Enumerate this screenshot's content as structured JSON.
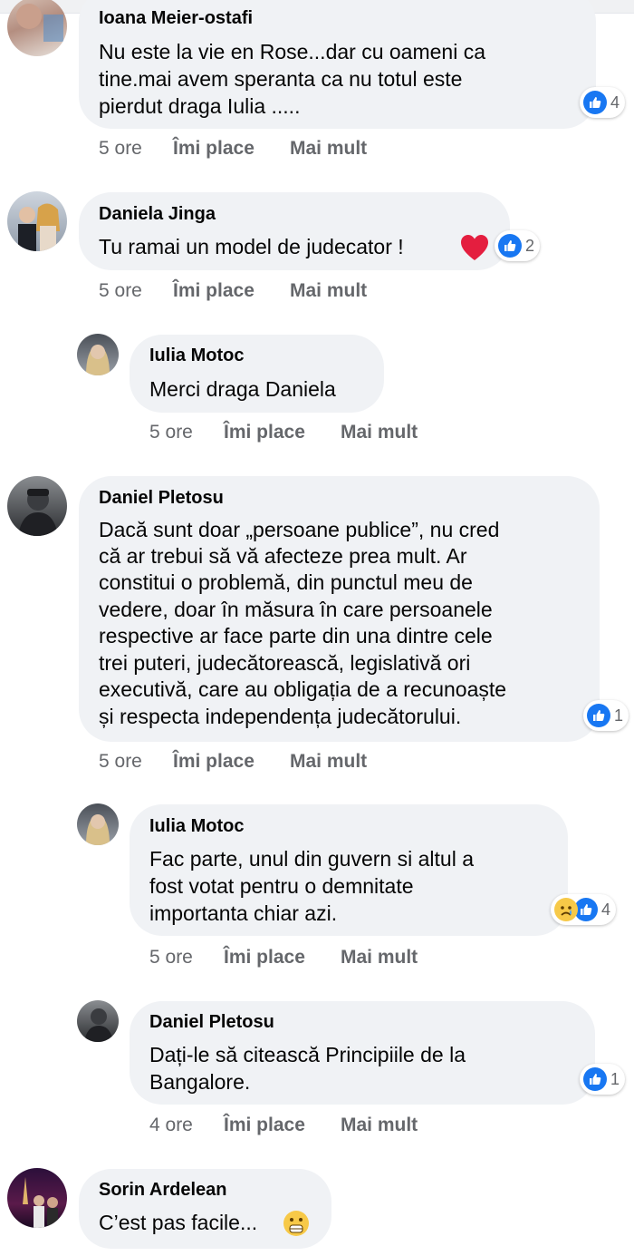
{
  "colors": {
    "bubble": "#f0f2f5",
    "like_blue": "#1877f2",
    "meta_gray": "#65676b",
    "heart_red": "#e41e3f"
  },
  "comments": [
    {
      "author": "Ioana Meier-ostafi",
      "lines": [
        "Nu este la vie en Rose...dar cu oameni ca",
        "tine.mai avem speranta ca nu totul este",
        "pierdut draga Iulia ....."
      ],
      "reaction_count": "4",
      "time": "5 ore",
      "like": "Îmi place",
      "more": "Mai mult"
    },
    {
      "author": "Daniela Jinga",
      "lines": [
        "Tu ramai un model de judecator !"
      ],
      "reaction_count": "2",
      "time": "5 ore",
      "like": "Îmi place",
      "more": "Mai mult"
    },
    {
      "author": "Iulia Motoc",
      "lines": [
        "Merci draga Daniela"
      ],
      "time": "5 ore",
      "like": "Îmi place",
      "more": "Mai mult"
    },
    {
      "author": "Daniel Pletosu",
      "lines": [
        "Dacă sunt doar „persoane publice”, nu cred",
        "că ar trebui să vă afecteze prea mult. Ar",
        "constitui o problemă, din punctul meu de",
        "vedere, doar în măsura în care persoanele",
        "respective ar face parte din una dintre cele",
        "trei puteri, judecătorească, legislativă ori",
        "executivă, care au obligația de a recunoaște",
        "și respecta independența judecătorului."
      ],
      "reaction_count": "1",
      "time": "5 ore",
      "like": "Îmi place",
      "more": "Mai mult"
    },
    {
      "author": "Iulia Motoc",
      "lines": [
        "Fac parte, unul din guvern si altul a",
        "fost votat pentru o demnitate",
        "importanta chiar azi."
      ],
      "reaction_count": "4",
      "time": "5 ore",
      "like": "Îmi place",
      "more": "Mai mult"
    },
    {
      "author": "Daniel Pletosu",
      "lines": [
        "Dați-le să citească Principiile de la",
        "Bangalore."
      ],
      "reaction_count": "1",
      "time": "4 ore",
      "like": "Îmi place",
      "more": "Mai mult"
    },
    {
      "author": "Sorin Ardelean",
      "lines": [
        "C’est pas facile..."
      ]
    }
  ]
}
